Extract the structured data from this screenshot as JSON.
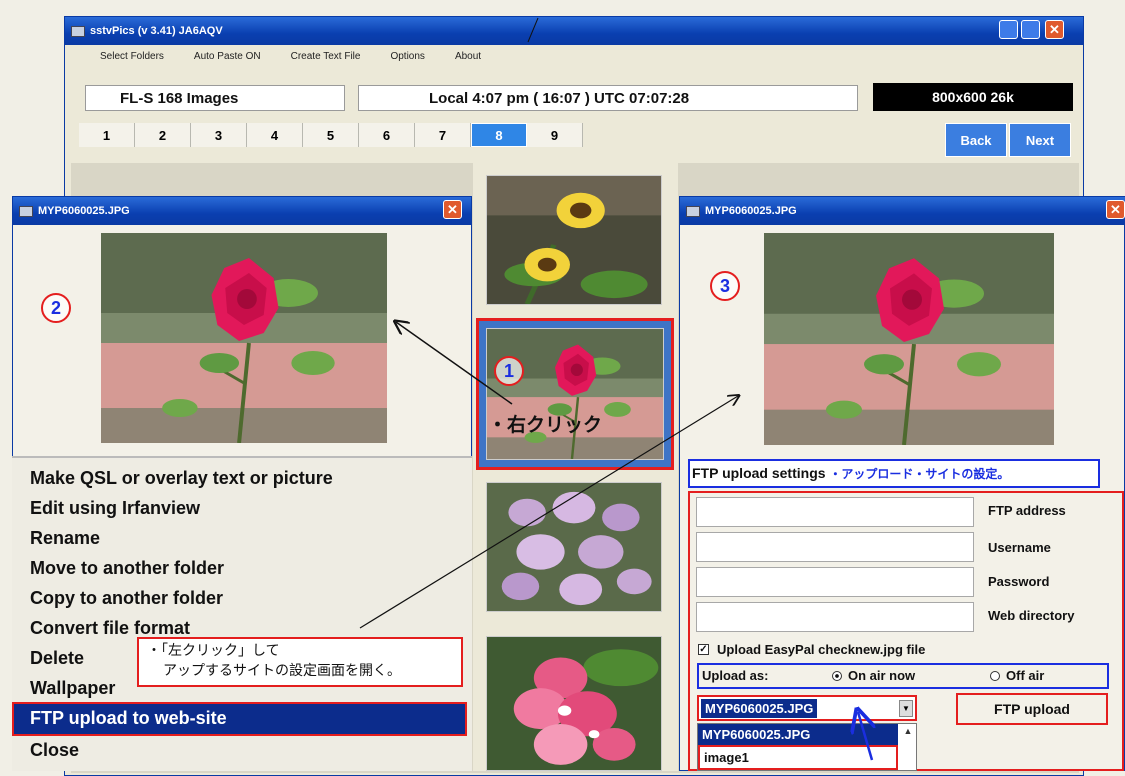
{
  "main_window": {
    "title": "sstvPics (v 3.41)  JA6AQV",
    "menu": [
      "Select Folders",
      "Auto Paste ON",
      "Create Text File",
      "Options",
      "About"
    ],
    "folder_status": "FL-S  168 Images",
    "time_status": "Local  4:07 pm  ( 16:07 )    UTC  07:07:28",
    "image_info": "800x600  26k",
    "page_tabs": [
      "1",
      "2",
      "3",
      "4",
      "5",
      "6",
      "7",
      "8",
      "9"
    ],
    "active_tab": "8",
    "back_label": "Back",
    "next_label": "Next"
  },
  "left_window": {
    "title": "MYP6060025.JPG",
    "step_marker": "2",
    "context_menu": [
      "Make QSL or overlay text or picture",
      "Edit using Irfanview",
      "Rename",
      "Move to another folder",
      "Copy to another folder",
      "Convert file format",
      "Delete",
      "Wallpaper",
      "FTP upload to web-site",
      "Close"
    ],
    "note_line1": "・「左クリック」して",
    "note_line2": "アップするサイトの設定画面を開く。"
  },
  "center_strip": {
    "step_marker": "1",
    "right_click_note": "・右クリック"
  },
  "right_window": {
    "title": "MYP6060025.JPG",
    "step_marker": "3",
    "ftp_heading": "FTP upload settings",
    "ftp_heading_note": "・アップロード・サイトの設定。",
    "fields": [
      {
        "label": "FTP address",
        "value": ""
      },
      {
        "label": "Username",
        "value": ""
      },
      {
        "label": "Password",
        "value": ""
      },
      {
        "label": "Web directory",
        "value": ""
      }
    ],
    "checkbox_label": "Upload EasyPal checknew.jpg file",
    "checkbox_checked": true,
    "upload_as_label": "Upload as:",
    "radio_on_air": "On air now",
    "radio_off_air": "Off air",
    "radio_selected": "On air now",
    "upload_select_value": "MYP6060025.JPG",
    "upload_select_options": [
      "MYP6060025.JPG",
      "image1"
    ],
    "ftp_upload_button": "FTP upload"
  },
  "colors": {
    "title_blue": "#0a3fb0",
    "accent_red": "#e41e1e",
    "accent_blue": "#1a2ee0",
    "menu_highlight": "#0c2c8c"
  }
}
